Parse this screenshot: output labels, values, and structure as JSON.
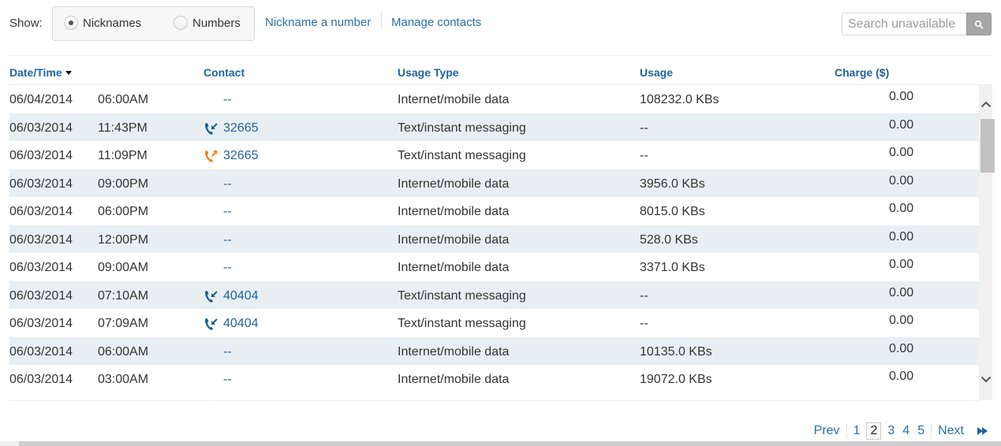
{
  "filter": {
    "show_label": "Show:",
    "options": [
      {
        "label": "Nicknames",
        "checked": true
      },
      {
        "label": "Numbers",
        "checked": false
      }
    ],
    "links": {
      "nickname": "Nickname a number",
      "manage": "Manage contacts"
    },
    "search": {
      "placeholder": "Search unavailable",
      "icon": "search-icon"
    }
  },
  "table": {
    "columns": {
      "datetime": "Date/Time",
      "contact": "Contact",
      "usage_type": "Usage Type",
      "usage": "Usage",
      "charge": "Charge ($)"
    },
    "sort": {
      "column": "Date/Time",
      "direction": "desc"
    },
    "rows": [
      {
        "date": "06/04/2014",
        "time": "06:00AM",
        "contact": "--",
        "direction": "",
        "type": "Internet/mobile data",
        "usage": "108232.0 KBs",
        "charge": "0.00"
      },
      {
        "date": "06/03/2014",
        "time": "11:43PM",
        "contact": "32665",
        "direction": "incoming",
        "type": "Text/instant messaging",
        "usage": "--",
        "charge": "0.00"
      },
      {
        "date": "06/03/2014",
        "time": "11:09PM",
        "contact": "32665",
        "direction": "outgoing",
        "type": "Text/instant messaging",
        "usage": "--",
        "charge": "0.00"
      },
      {
        "date": "06/03/2014",
        "time": "09:00PM",
        "contact": "--",
        "direction": "",
        "type": "Internet/mobile data",
        "usage": "3956.0 KBs",
        "charge": "0.00"
      },
      {
        "date": "06/03/2014",
        "time": "06:00PM",
        "contact": "--",
        "direction": "",
        "type": "Internet/mobile data",
        "usage": "8015.0 KBs",
        "charge": "0.00"
      },
      {
        "date": "06/03/2014",
        "time": "12:00PM",
        "contact": "--",
        "direction": "",
        "type": "Internet/mobile data",
        "usage": "528.0 KBs",
        "charge": "0.00"
      },
      {
        "date": "06/03/2014",
        "time": "09:00AM",
        "contact": "--",
        "direction": "",
        "type": "Internet/mobile data",
        "usage": "3371.0 KBs",
        "charge": "0.00"
      },
      {
        "date": "06/03/2014",
        "time": "07:10AM",
        "contact": "40404",
        "direction": "incoming",
        "type": "Text/instant messaging",
        "usage": "--",
        "charge": "0.00"
      },
      {
        "date": "06/03/2014",
        "time": "07:09AM",
        "contact": "40404",
        "direction": "incoming",
        "type": "Text/instant messaging",
        "usage": "--",
        "charge": "0.00"
      },
      {
        "date": "06/03/2014",
        "time": "06:00AM",
        "contact": "--",
        "direction": "",
        "type": "Internet/mobile data",
        "usage": "10135.0 KBs",
        "charge": "0.00"
      },
      {
        "date": "06/03/2014",
        "time": "03:00AM",
        "contact": "--",
        "direction": "",
        "type": "Internet/mobile data",
        "usage": "19072.0 KBs",
        "charge": "0.00"
      }
    ]
  },
  "pagination": {
    "prev": "Prev",
    "pages": [
      "1",
      "2",
      "3",
      "4",
      "5"
    ],
    "current": "2",
    "next": "Next"
  },
  "colors": {
    "link": "#2a6ea6",
    "header": "#1e64a0",
    "incoming": "#1a5e8a",
    "outgoing": "#f07f1f",
    "row_alt": "#e8eff3"
  }
}
